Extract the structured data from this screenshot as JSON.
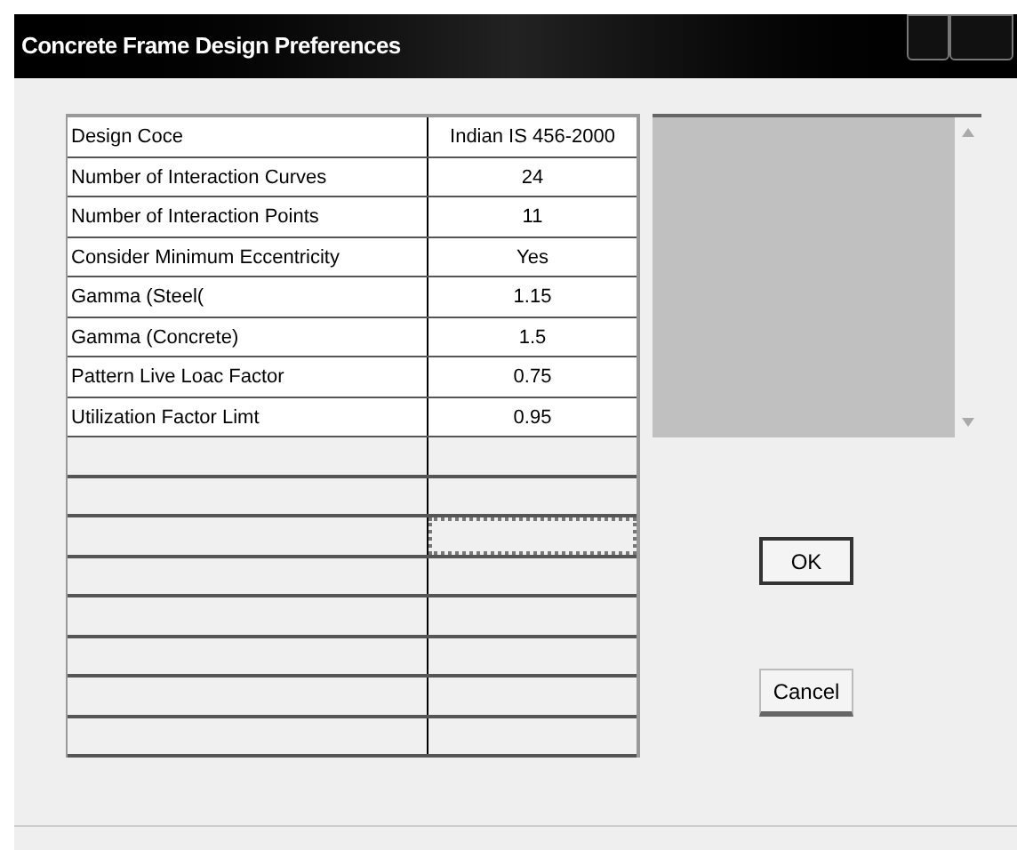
{
  "window": {
    "title": "Concrete Frame Design Preferences"
  },
  "table": {
    "rows": [
      {
        "label": "Design Coce",
        "value": "Indian IS 456-2000"
      },
      {
        "label": "Number of Interaction Curves",
        "value": "24"
      },
      {
        "label": "Number of Interaction Points",
        "value": "11"
      },
      {
        "label": "Consider Minimum Eccentricity",
        "value": "Yes"
      },
      {
        "label": "Gamma (Steel(",
        "value": "1.15"
      },
      {
        "label": "Gamma (Concrete)",
        "value": "1.5"
      },
      {
        "label": "Pattern Live Loac Factor",
        "value": "0.75"
      },
      {
        "label": "Utilization Factor Limt",
        "value": "0.95"
      }
    ],
    "empty_rows": [
      {
        "focused": false
      },
      {
        "focused": false
      },
      {
        "focused": true
      },
      {
        "focused": false
      },
      {
        "focused": false
      },
      {
        "focused": false
      },
      {
        "focused": false
      },
      {
        "focused": false
      }
    ]
  },
  "buttons": [
    {
      "label": "OK",
      "default": true
    },
    {
      "label": "Cancel",
      "default": false
    }
  ]
}
